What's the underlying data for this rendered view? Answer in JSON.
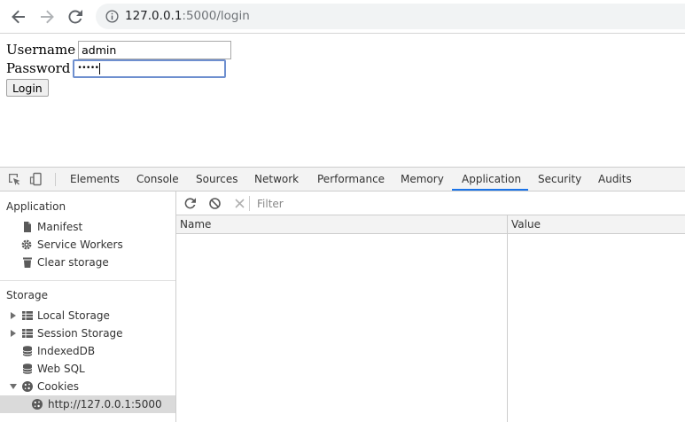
{
  "browser": {
    "url_host": "127.0.0.1",
    "url_path": ":5000/login",
    "icons": [
      "back-arrow-icon",
      "forward-arrow-icon",
      "reload-icon",
      "info-icon"
    ]
  },
  "page": {
    "username_label": "Username",
    "username_value": "admin",
    "password_label": "Password",
    "password_value": "•••••",
    "login_label": "Login"
  },
  "devtools": {
    "tabs": [
      "Elements",
      "Console",
      "Sources",
      "Network",
      "Performance",
      "Memory",
      "Application",
      "Security",
      "Audits"
    ],
    "active_tab": "Application",
    "accent_color": "#1a73e8",
    "sidebar": {
      "application_header": "Application",
      "application_items": [
        "Manifest",
        "Service Workers",
        "Clear storage"
      ],
      "storage_header": "Storage",
      "storage_items": [
        "Local Storage",
        "Session Storage",
        "IndexedDB",
        "Web SQL",
        "Cookies"
      ],
      "cookie_origin": "http://127.0.0.1:5000"
    },
    "main": {
      "filter_placeholder": "Filter",
      "columns": [
        "Name",
        "Value"
      ]
    }
  }
}
